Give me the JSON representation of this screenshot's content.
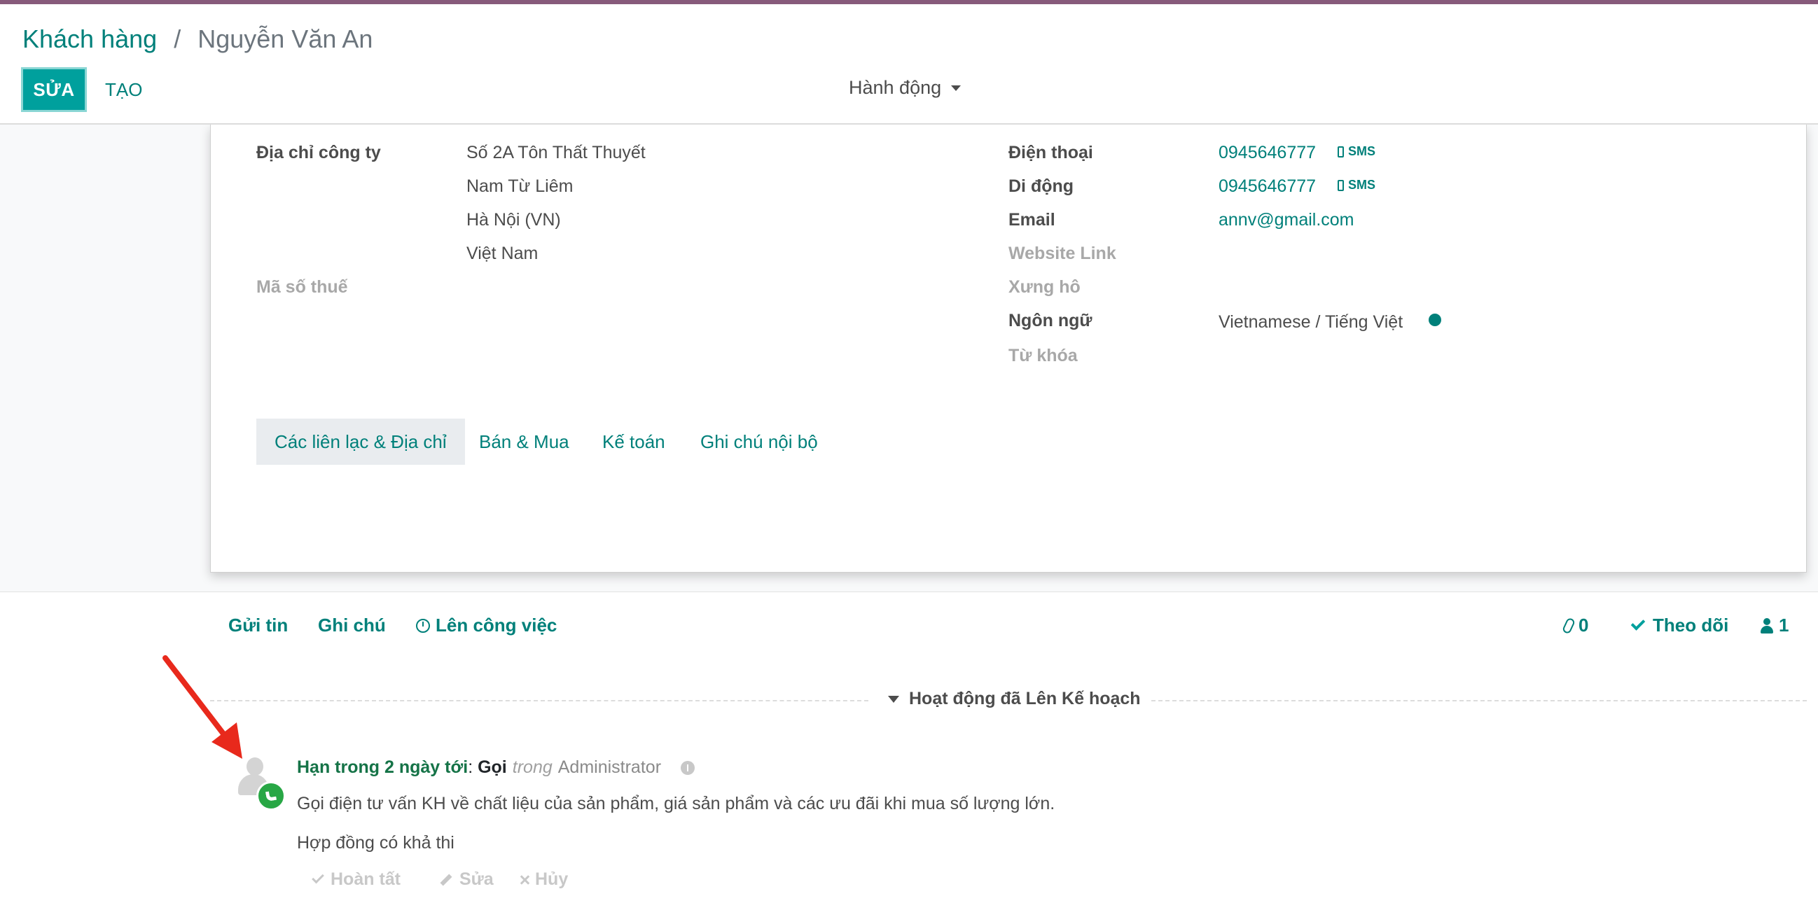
{
  "breadcrumb": {
    "parent": "Khách hàng",
    "separator": "/",
    "current": "Nguyễn Văn An"
  },
  "control_panel": {
    "edit_label": "SỬA",
    "create_label": "TẠO",
    "actions_label": "Hành động"
  },
  "form": {
    "left": {
      "address_label": "Địa chỉ công ty",
      "address_lines": [
        "Số 2A Tôn Thất Thuyết",
        "Nam Từ Liêm",
        "Hà Nội (VN)",
        "Việt Nam"
      ],
      "tax_label": "Mã số thuế"
    },
    "right": {
      "phone_label": "Điện thoại",
      "phone_value": "0945646777",
      "mobile_label": "Di động",
      "mobile_value": "0945646777",
      "sms_label": "SMS",
      "email_label": "Email",
      "email_value": "annv@gmail.com",
      "website_label": "Website Link",
      "title_label": "Xưng hô",
      "language_label": "Ngôn ngữ",
      "language_value": "Vietnamese / Tiếng Việt",
      "tags_label": "Từ khóa"
    },
    "tabs": [
      "Các liên lạc & Địa chỉ",
      "Bán & Mua",
      "Kế toán",
      "Ghi chú nội bộ"
    ]
  },
  "chatter": {
    "send_message": "Gửi tin",
    "log_note": "Ghi chú",
    "schedule_activity": "Lên công việc",
    "attachments_count": "0",
    "follow_label": "Theo dõi",
    "followers_count": "1",
    "planned_title": "Hoạt động đã Lên Kế hoạch"
  },
  "activity": {
    "due": "Hạn trong 2 ngày tới",
    "type": "Gọi",
    "in_word": "trong",
    "assignee": "Administrator",
    "note": "Gọi điện tư vấn KH về chất liệu của sản phẩm, giá sản phẩm và các ưu đãi khi mua số lượng lớn.",
    "summary": "Hợp đồng có khả thi",
    "done_label": "Hoàn tất",
    "edit_label": "Sửa",
    "cancel_label": "Hủy"
  },
  "colors": {
    "brand": "#875a7b",
    "primary": "#00a09d",
    "link": "#00807a",
    "annotation": "#e8291c",
    "activity_badge": "#28a745"
  }
}
